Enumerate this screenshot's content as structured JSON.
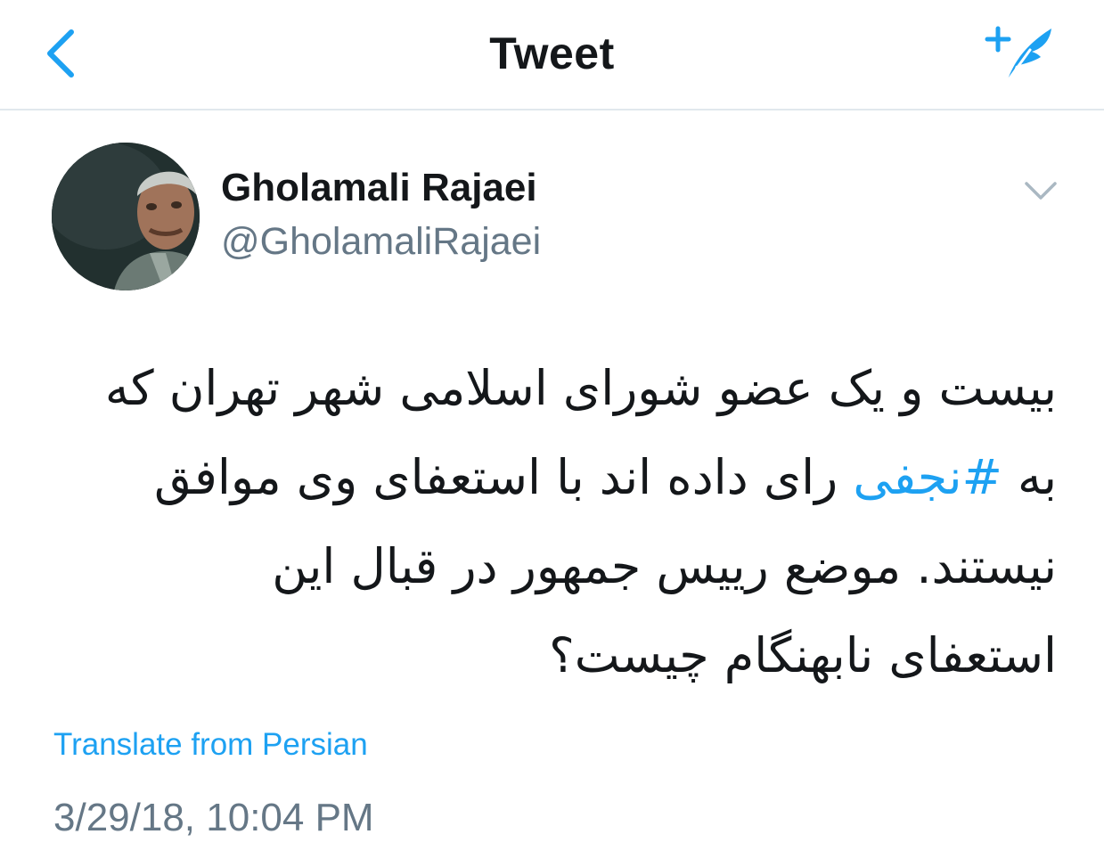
{
  "header": {
    "title": "Tweet",
    "back_icon": "chevron-left-icon",
    "compose_icon": "compose-tweet-icon",
    "accent": "#1da1f2"
  },
  "tweet": {
    "author": {
      "display_name": "Gholamali Rajaei",
      "handle": "@GholamaliRajaei"
    },
    "text_lines": {
      "line1": "بیست و یک عضو شورای اسلامی شهر تهران که",
      "line2_before": "به ",
      "line2_hashtag": "#نجفی",
      "line2_after": " رای داده اند با  استعفای وی موافق",
      "line3": "نیستند. موضع رییس جمهور در قبال این",
      "line4": "استعفای نابهنگام چیست؟"
    },
    "translate_label": "Translate from Persian",
    "timestamp": "3/29/18, 10:04 PM"
  },
  "colors": {
    "text": "#14171a",
    "secondary": "#657786",
    "link": "#1da1f2",
    "divider": "#e1e8ed"
  }
}
